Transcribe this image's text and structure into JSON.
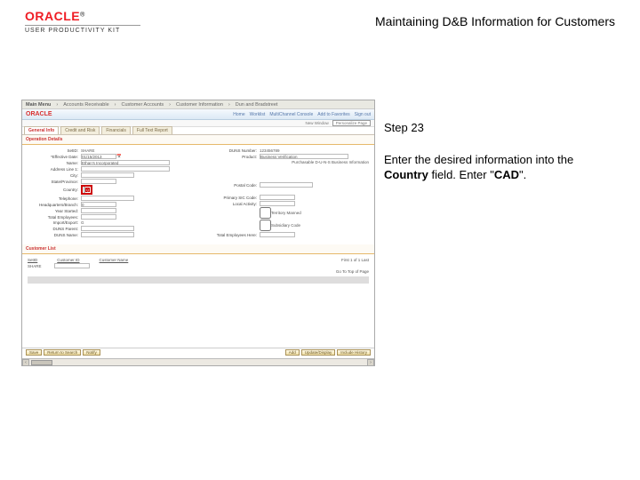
{
  "header": {
    "logo_text": "ORACLE",
    "logo_suffix": "®",
    "logo_sub": "USER PRODUCTIVITY KIT",
    "title": "Maintaining D&B Information for Customers"
  },
  "instruction": {
    "step": "Step 23",
    "line1": "Enter the desired information into the ",
    "field_name": "Country",
    "line2": " field. Enter \"",
    "value": "CAD",
    "line3": "\"."
  },
  "shot": {
    "topbar": {
      "primary": "Main Menu",
      "items": [
        "Accounts Receivable",
        "Customer Accounts",
        "Customer Information",
        "Dun and Bradstreet"
      ]
    },
    "oraclebar": {
      "brand": "ORACLE",
      "links": [
        "Home",
        "Worklist",
        "MultiChannel Console",
        "Add to Favorites",
        "Sign out"
      ]
    },
    "crumb": {
      "name": "New Window",
      "btn": "Personalize Page"
    },
    "tabs": [
      {
        "label": "General Info",
        "active": true
      },
      {
        "label": "Credit and Risk",
        "active": false
      },
      {
        "label": "Financials",
        "active": false
      },
      {
        "label": "Full Text Report",
        "active": false
      }
    ],
    "sections": {
      "operation": {
        "heading": "Operation Details",
        "setid_label": "SetID:",
        "setid_value": "SHARE",
        "duns_label": "DUNS Number:",
        "duns_value": "123456789",
        "effdate_label": "*Effective Date:",
        "effdate_value": "01/15/2013",
        "name_label": "Name:",
        "name_value": "Ethan's Incorporated",
        "addr_label": "Address Line 1:",
        "addr_value": "",
        "city_label": "City:",
        "city_value": "",
        "region_label": "State/Province:",
        "region_value": "",
        "country_label": "Country:",
        "country_value": "",
        "phone_label": "Telephone:",
        "phone_value": "",
        "hq_label": "Headquarters/Branch:",
        "hq_value": "0",
        "yrstarted_label": "Year Started:",
        "emp_label": "Total Employees:",
        "import_label": "Import/Export:",
        "import_value": "G",
        "dunsparent_label": "DUNS Parent:",
        "dunsgu_label": "DUNS Name:",
        "purch_label": "Purchasable D-U-N-S Business Information",
        "product_label": "Product:",
        "product_value": "Business Verification",
        "postal_label": "Postal Code:",
        "primsic_label": "Primary SIC Code:",
        "localact_label": "Local Activity:",
        "tm_label": "Territory Manned",
        "sub_label": "Subsidiary Code",
        "totemphere_label": "Total Employees Here:",
        "lookup_hint": "Look up"
      },
      "custlist": {
        "heading": "Customer List",
        "cols": [
          "SetID",
          "Customer ID",
          "Customer Name"
        ],
        "row": {
          "setid": "SHARE"
        },
        "pager": "First  1 of 1  Last",
        "goto": "Go To   Top of Page"
      }
    },
    "bottombar": {
      "left": [
        "Save",
        "Return to Search",
        "Notify"
      ],
      "right": [
        "Add",
        "Update/Display",
        "Include History"
      ]
    }
  }
}
